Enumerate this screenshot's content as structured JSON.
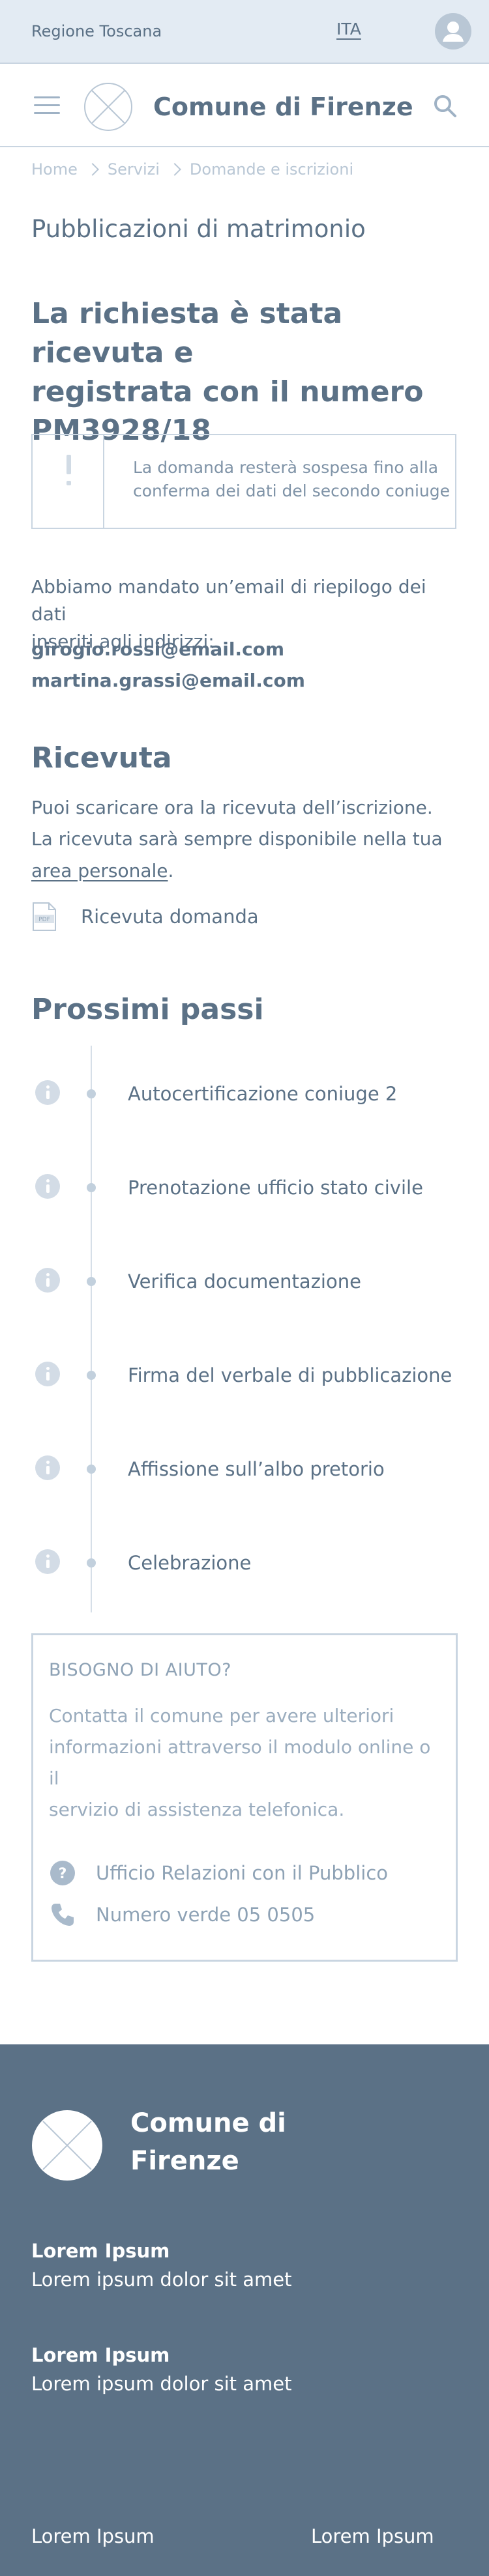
{
  "topbar": {
    "region": "Regione Toscana",
    "language": "ITA",
    "user_icon": "user-icon"
  },
  "header": {
    "title": "Comune di Firenze",
    "menu_icon": "menu-icon",
    "search_icon": "search-icon",
    "logo_icon": "logo-placeholder-icon"
  },
  "breadcrumb": [
    "Home",
    "Servizi",
    "Domande e iscrizioni"
  ],
  "page_title": "Pubblicazioni di matrimonio",
  "confirmation": {
    "heading_lines": [
      "La richiesta è stata ricevuta e",
      "registrata con il numero",
      "PM3928/18"
    ],
    "alert_lines": [
      "La domanda resterà sospesa fino alla",
      "conferma dei dati del secondo coniuge"
    ],
    "email_intro_lines": [
      "Abbiamo mandato un’email di riepilogo dei dati",
      "inseriti agli indirizzi:"
    ],
    "emails": [
      "girogio.rossi@email.com",
      "martina.grassi@email.com"
    ]
  },
  "receipt": {
    "title": "Ricevuta",
    "line1": "Puoi scaricare ora la ricevuta dell’iscrizione.",
    "line2": "La ricevuta sarà sempre disponibile nella tua",
    "link": "area personale",
    "link_suffix": ".",
    "file_label": "Ricevuta domanda",
    "file_icon": "pdf-file-icon"
  },
  "next_steps": {
    "title": "Prossimi passi",
    "items": [
      "Autocertificazione coniuge 2",
      "Prenotazione ufficio stato civile",
      "Verifica documentazione",
      "Firma del verbale di pubblicazione",
      "Affissione sull’albo pretorio",
      "Celebrazione"
    ]
  },
  "help": {
    "title": "BISOGNO DI AIUTO?",
    "text_lines": [
      "Contatta il comune per avere ulteriori",
      "informazioni attraverso il modulo online o il",
      "servizio di assistenza telefonica."
    ],
    "office": "Ufficio Relazioni con il Pubblico",
    "phone": "Numero verde 05 0505"
  },
  "footer": {
    "title_lines": [
      "Comune di",
      "Firenze"
    ],
    "blocks": [
      {
        "heading": "Lorem Ipsum",
        "text": "Lorem ipsum dolor sit amet"
      },
      {
        "heading": "Lorem Ipsum",
        "text": "Lorem ipsum dolor sit amet"
      }
    ],
    "links": [
      "Lorem Ipsum",
      "Lorem Ipsum"
    ]
  },
  "colors": {
    "primary": "#5b7186",
    "topbar_bg": "#e3ebf3",
    "border": "#c9d5e1",
    "footer_bg": "#5b7186"
  }
}
